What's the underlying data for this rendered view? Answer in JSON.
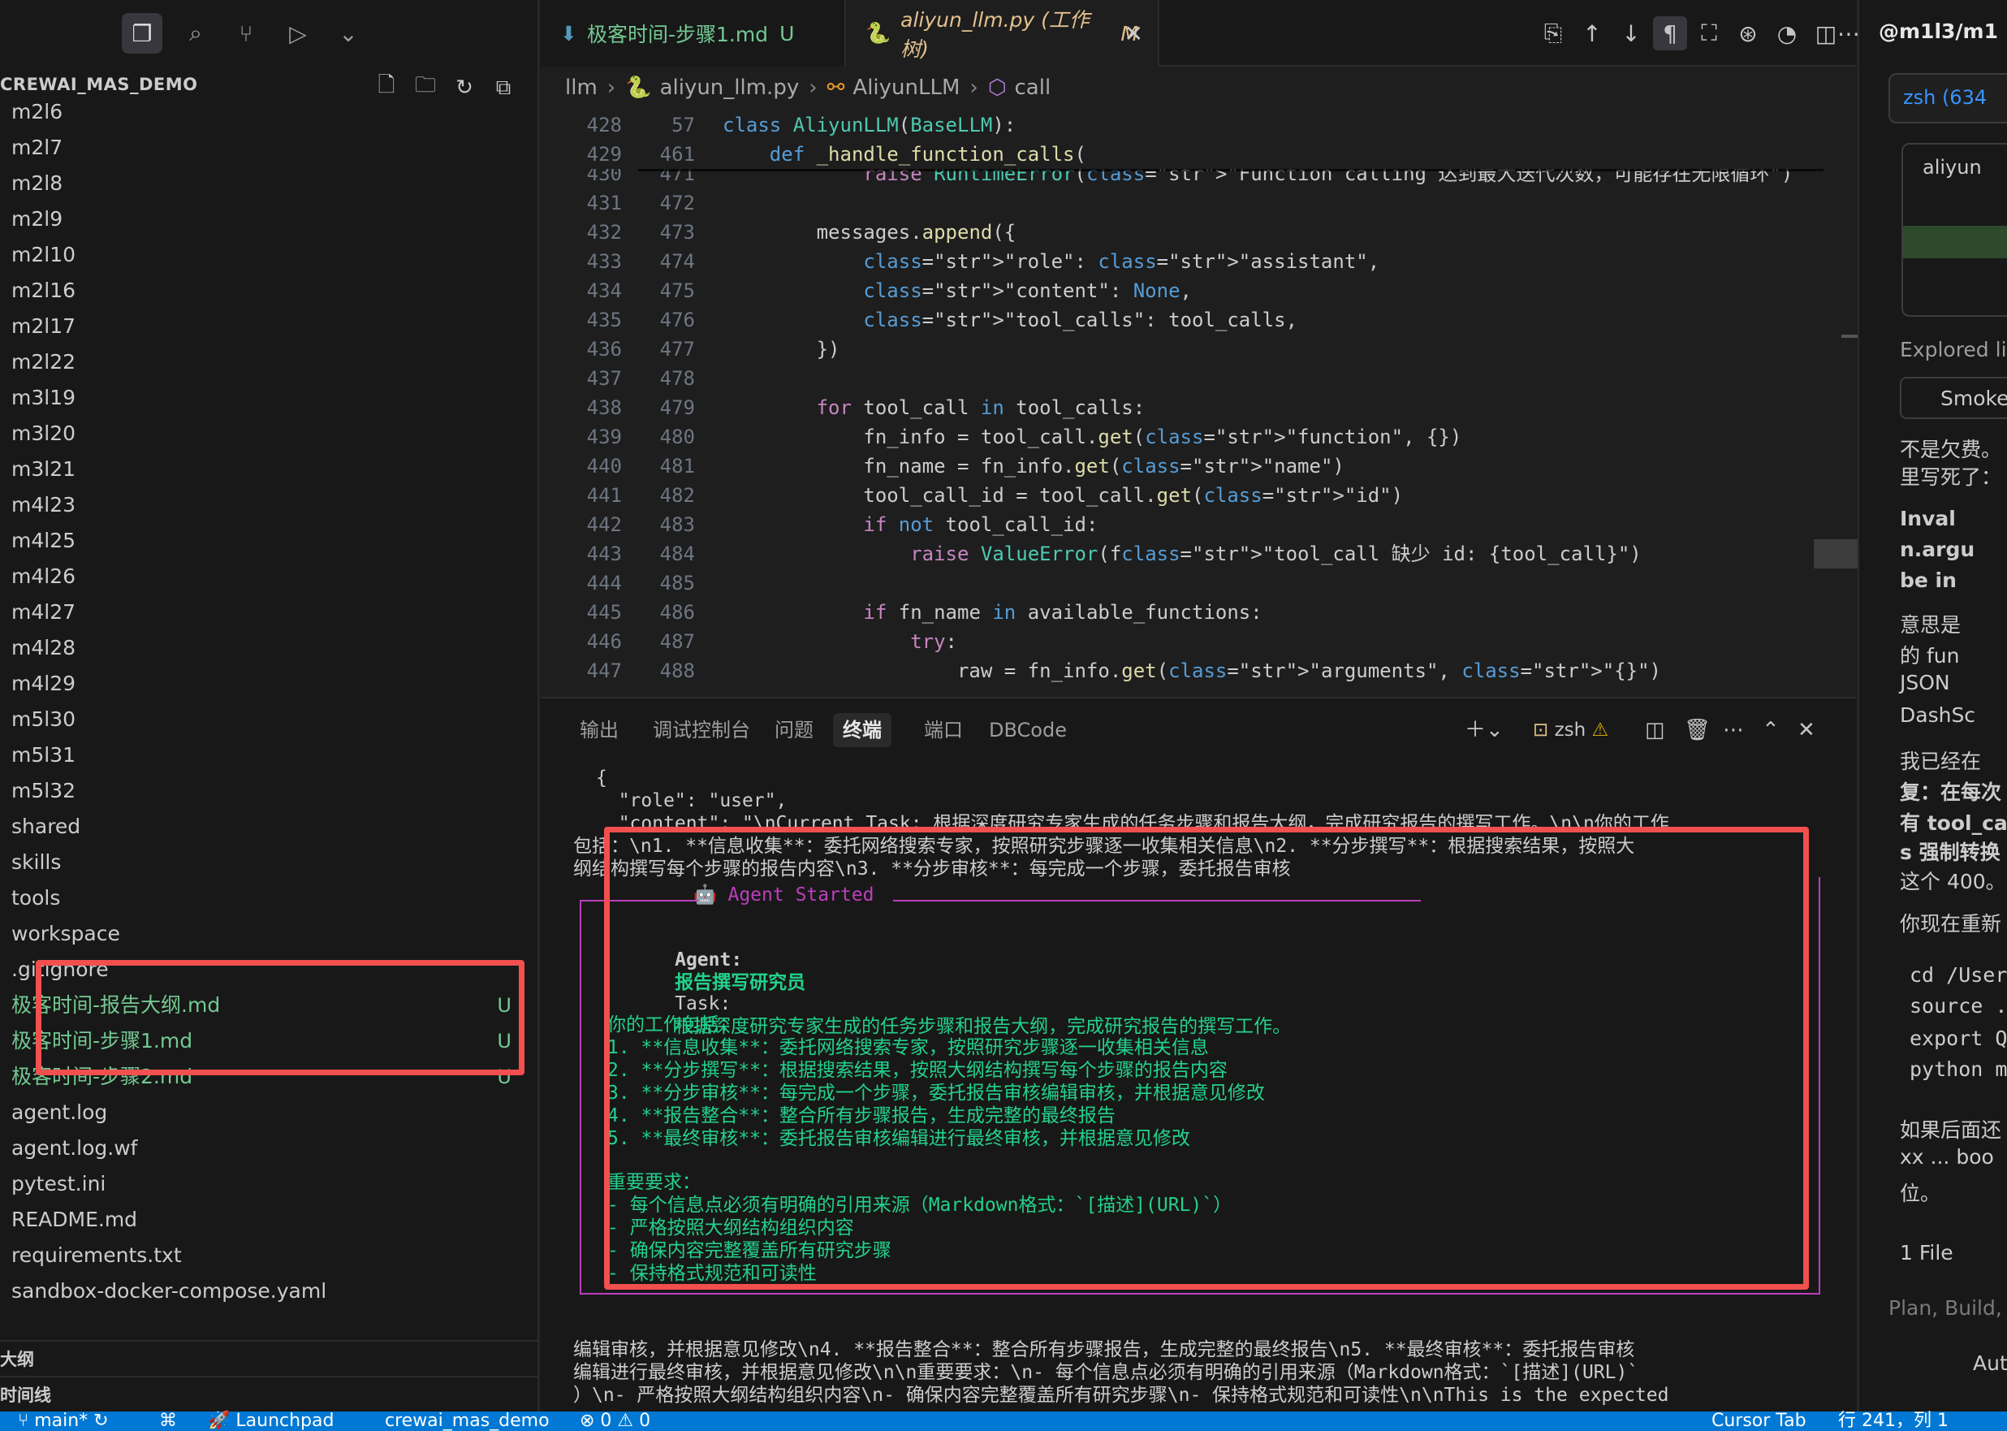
{
  "sidebar": {
    "title": "CREWAI_MAS_DEMO",
    "toolbar_icons": [
      "explorer-icon",
      "search-icon",
      "source-control-icon",
      "run-debug-icon",
      "chevron-down-icon"
    ],
    "items": [
      {
        "label": "m2l6",
        "status": ""
      },
      {
        "label": "m2l7",
        "status": ""
      },
      {
        "label": "m2l8",
        "status": ""
      },
      {
        "label": "m2l9",
        "status": ""
      },
      {
        "label": "m2l10",
        "status": ""
      },
      {
        "label": "m2l16",
        "status": ""
      },
      {
        "label": "m2l17",
        "status": ""
      },
      {
        "label": "m2l22",
        "status": ""
      },
      {
        "label": "m3l19",
        "status": ""
      },
      {
        "label": "m3l20",
        "status": ""
      },
      {
        "label": "m3l21",
        "status": ""
      },
      {
        "label": "m4l23",
        "status": ""
      },
      {
        "label": "m4l25",
        "status": ""
      },
      {
        "label": "m4l26",
        "status": ""
      },
      {
        "label": "m4l27",
        "status": ""
      },
      {
        "label": "m4l28",
        "status": ""
      },
      {
        "label": "m4l29",
        "status": ""
      },
      {
        "label": "m5l30",
        "status": ""
      },
      {
        "label": "m5l31",
        "status": ""
      },
      {
        "label": "m5l32",
        "status": ""
      },
      {
        "label": "shared",
        "status": ""
      },
      {
        "label": "skills",
        "status": ""
      },
      {
        "label": "tools",
        "status": ""
      },
      {
        "label": "workspace",
        "status": ""
      },
      {
        "label": ".gitignore",
        "status": ""
      },
      {
        "label": "极客时间-报告大纲.md",
        "status": "U"
      },
      {
        "label": "极客时间-步骤1.md",
        "status": "U"
      },
      {
        "label": "极客时间-步骤2.md",
        "status": "U"
      },
      {
        "label": "agent.log",
        "status": ""
      },
      {
        "label": "agent.log.wf",
        "status": ""
      },
      {
        "label": "pytest.ini",
        "status": ""
      },
      {
        "label": "README.md",
        "status": ""
      },
      {
        "label": "requirements.txt",
        "status": ""
      },
      {
        "label": "sandbox-docker-compose.yaml",
        "status": ""
      }
    ],
    "outline_label": "大纲",
    "timeline_label": "时间线"
  },
  "editor": {
    "tabs": [
      {
        "label": "极客时间-步骤1.md",
        "status": "U"
      },
      {
        "label": "aliyun_llm.py (工作树)",
        "status": "M"
      }
    ],
    "breadcrumb": [
      "llm",
      "aliyun_llm.py",
      "AliyunLLM",
      "call"
    ],
    "sticky": [
      {
        "ln1": "428",
        "ln2": "57",
        "text": "class AliyunLLM(BaseLLM):"
      },
      {
        "ln1": "429",
        "ln2": "461",
        "text": "    def _handle_function_calls("
      }
    ],
    "lines": [
      {
        "ln1": "430",
        "ln2": "471",
        "text": "            raise RuntimeError(\"Function calling 达到最大迭代次数，可能存在无限循环\")"
      },
      {
        "ln1": "431",
        "ln2": "472",
        "text": ""
      },
      {
        "ln1": "432",
        "ln2": "473",
        "text": "        messages.append({"
      },
      {
        "ln1": "433",
        "ln2": "474",
        "text": "            \"role\": \"assistant\","
      },
      {
        "ln1": "434",
        "ln2": "475",
        "text": "            \"content\": None,"
      },
      {
        "ln1": "435",
        "ln2": "476",
        "text": "            \"tool_calls\": tool_calls,"
      },
      {
        "ln1": "436",
        "ln2": "477",
        "text": "        })"
      },
      {
        "ln1": "437",
        "ln2": "478",
        "text": ""
      },
      {
        "ln1": "438",
        "ln2": "479",
        "text": "        for tool_call in tool_calls:"
      },
      {
        "ln1": "439",
        "ln2": "480",
        "text": "            fn_info = tool_call.get(\"function\", {})"
      },
      {
        "ln1": "440",
        "ln2": "481",
        "text": "            fn_name = fn_info.get(\"name\")"
      },
      {
        "ln1": "441",
        "ln2": "482",
        "text": "            tool_call_id = tool_call.get(\"id\")"
      },
      {
        "ln1": "442",
        "ln2": "483",
        "text": "            if not tool_call_id:"
      },
      {
        "ln1": "443",
        "ln2": "484",
        "text": "                raise ValueError(f\"tool_call 缺少 id: {tool_call}\")"
      },
      {
        "ln1": "444",
        "ln2": "485",
        "text": ""
      },
      {
        "ln1": "445",
        "ln2": "486",
        "text": "            if fn_name in available_functions:"
      },
      {
        "ln1": "446",
        "ln2": "487",
        "text": "                try:"
      },
      {
        "ln1": "447",
        "ln2": "488",
        "text": "                    raw = fn_info.get(\"arguments\", \"{}\")"
      }
    ]
  },
  "panel": {
    "tabs": [
      "输出",
      "调试控制台",
      "问题",
      "终端",
      "端口",
      "DBCode"
    ],
    "active_tab": "终端",
    "shell_label": "zsh",
    "terminal_lines": [
      "{",
      "  \"role\": \"user\",",
      "  \"content\": \"\\nCurrent Task: 根据深度研究专家生成的任务步骤和报告大纲，完成研究报告的撰写工作。\\n\\n你的工作",
      "包括：\\n1. **信息收集**：委托网络搜索专家，按照研究步骤逐一收集相关信息\\n2. **分步撰写**：根据搜索结果，按照大",
      "纲结构撰写每个步骤的报告内容\\n3. **分步审核**：每完成一个步骤，委托报告审核"
    ],
    "agent_box_title": "🤖 Agent Started",
    "agent_label": "Agent:",
    "agent_name": "报告撰写研究员",
    "task_label": "Task:",
    "task_text": "根据深度研究专家生成的任务步骤和报告大纲，完成研究报告的撰写工作。",
    "work_header": "你的工作包括：",
    "work_items": [
      "1. **信息收集**：委托网络搜索专家，按照研究步骤逐一收集相关信息",
      "2. **分步撰写**：根据搜索结果，按照大纲结构撰写每个步骤的报告内容",
      "3. **分步审核**：每完成一个步骤，委托报告审核编辑审核，并根据意见修改",
      "4. **报告整合**：整合所有步骤报告，生成完整的最终报告",
      "5. **最终审核**：委托报告审核编辑进行最终审核，并根据意见修改"
    ],
    "req_header": "重要要求：",
    "req_items": [
      "- 每个信息点必须有明确的引用来源（Markdown格式：`[描述](URL)`）",
      "- 严格按照大纲结构组织内容",
      "- 确保内容完整覆盖所有研究步骤",
      "- 保持格式规范和可读性"
    ],
    "bottom_lines": [
      "编辑审核，并根据意见修改\\n4. **报告整合**：整合所有步骤报告，生成完整的最终报告\\n5. **最终审核**：委托报告审核",
      "编辑进行最终审核，并根据意见修改\\n\\n重要要求：\\n- 每个信息点必须有明确的引用来源（Markdown格式：`[描述](URL)`",
      "）\\n- 严格按照大纲结构组织内容\\n- 确保内容完整覆盖所有研究步骤\\n- 保持格式规范和可读性\\n\\nThis is the expected"
    ]
  },
  "chat": {
    "header": "@m1l3/m1",
    "terminal_chip": "zsh (634",
    "file_chip": "aliyun",
    "explored": "Explored lin",
    "smoke": "Smoke",
    "lines": [
      "不是欠费。",
      "里写死了：",
      "Inval",
      "n.argu",
      "be in",
      "意思是",
      "的 fun",
      "JSON",
      "DashSc",
      "我已经在",
      "复：在每次",
      "有 tool_ca",
      "s 强制转换",
      "这个 400。",
      "你现在重新",
      "cd /Users",
      "source .",
      "export QW",
      "python ml",
      "如果后面还",
      "xx ... boo",
      "位。",
      "1 File",
      "Plan, Build, /",
      "Auto"
    ]
  },
  "statusbar": {
    "branch": "main*",
    "launchpad": "Launchpad",
    "workspace": "crewai_mas_demo",
    "problems": "⊗ 0 ⚠ 0",
    "cursor_tab": "Cursor Tab",
    "position": "行 241，列 1"
  },
  "colors": {
    "accent_blue": "#0078d4",
    "highlight_red": "#f24f4f",
    "git_untracked": "#73c991",
    "terminal_green": "#23d18b"
  }
}
